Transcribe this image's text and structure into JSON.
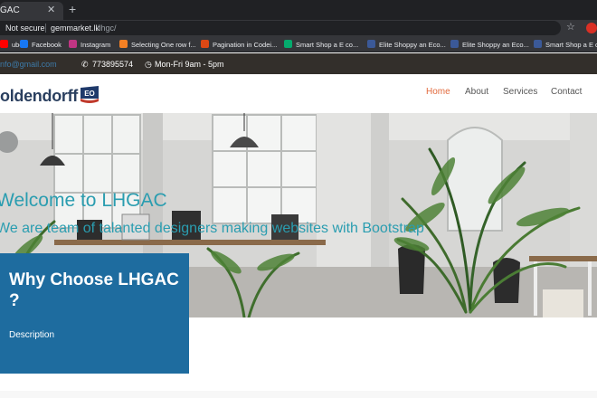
{
  "browser": {
    "tab_title": "GAC",
    "new_tab_symbol": "+",
    "close_symbol": "✕",
    "security_label": "Not secure",
    "url_domain": "gemmarket.lk",
    "url_path": "/lhgc/",
    "bookmarks": [
      {
        "label": "ube",
        "icon": "youtube-icon",
        "color": "#ff0000"
      },
      {
        "label": "Facebook",
        "icon": "facebook-icon",
        "color": "#1877f2"
      },
      {
        "label": "Instagram",
        "icon": "instagram-icon",
        "color": "#c13584"
      },
      {
        "label": "Selecting One row f...",
        "icon": "stackoverflow-icon",
        "color": "#f48024"
      },
      {
        "label": "Pagination in Codei...",
        "icon": "codeigniter-icon",
        "color": "#dd4814"
      },
      {
        "label": "Smart Shop a E co...",
        "icon": "w3schools-icon",
        "color": "#04aa6d"
      },
      {
        "label": "Elite Shoppy an Eco...",
        "icon": "w3layouts-icon",
        "color": "#3b5998"
      },
      {
        "label": "Elite Shoppy an Eco...",
        "icon": "w3layouts-icon",
        "color": "#3b5998"
      },
      {
        "label": "Smart Shop a E co...",
        "icon": "w3layouts-icon",
        "color": "#3b5998"
      }
    ]
  },
  "site": {
    "topbar": {
      "email": "nfo@gmail.com",
      "phone": "773895574",
      "hours": "Mon-Fri 9am - 5pm"
    },
    "logo": {
      "text": "oldendorff",
      "badge": "EO"
    },
    "nav": [
      {
        "label": "Home",
        "active": true
      },
      {
        "label": "About",
        "active": false
      },
      {
        "label": "Services",
        "active": false
      },
      {
        "label": "Contact",
        "active": false
      }
    ],
    "hero": {
      "title": "Welcome to LHGAC",
      "subtitle": "We are team of talanted designers making websites with Bootstrap"
    },
    "why": {
      "title": "Why Choose LHGAC ?",
      "description": "Description"
    },
    "colors": {
      "accent": "#e26a3d",
      "hero_text": "#2a9db0",
      "why_box": "#1e6c9f",
      "topbar": "#332f2b"
    }
  }
}
